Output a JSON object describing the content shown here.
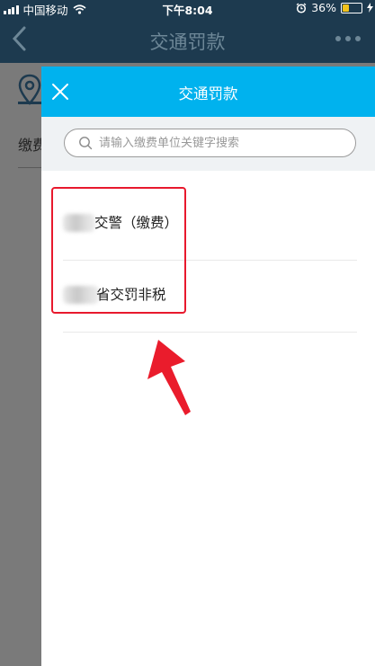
{
  "status_bar": {
    "carrier": "中国移动",
    "wifi_icon": "wifi-icon",
    "time": "下午8:04",
    "alarm_icon": "alarm-icon",
    "battery_percent": "36%",
    "battery_level": 0.36,
    "battery_color": "#f2c21b"
  },
  "background_page": {
    "title": "交通罚款",
    "back_icon": "chevron-left-icon",
    "more_icon": "more-dots-icon",
    "location_icon": "location-pin-icon",
    "row_label": "缴费"
  },
  "modal": {
    "title": "交通罚款",
    "header_color": "#00b2ee",
    "close_icon": "close-icon",
    "search": {
      "placeholder": "请输入缴费单位关键字搜索",
      "value": "",
      "icon": "search-icon"
    },
    "items": [
      {
        "label": "交警（缴费）"
      },
      {
        "label": "省交罚非税"
      }
    ]
  },
  "annotation": {
    "highlight_color": "#e8192d",
    "arrow_icon": "red-arrow-icon"
  }
}
